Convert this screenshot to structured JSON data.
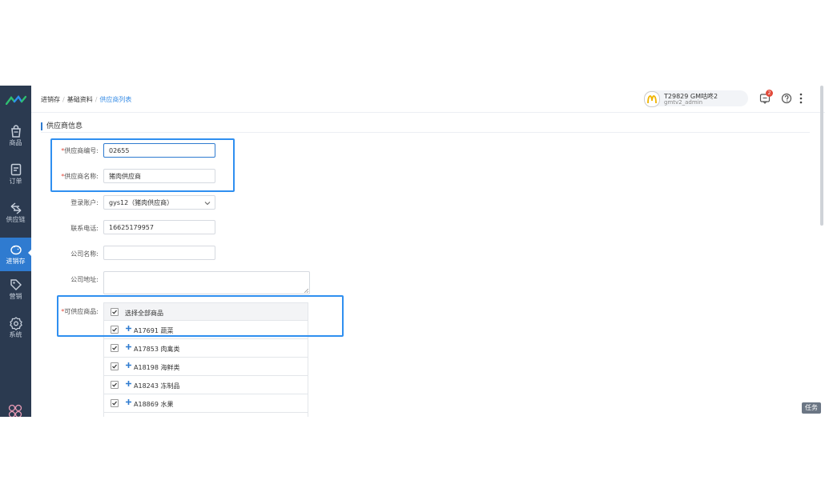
{
  "sidebar": {
    "items": [
      {
        "label": "商品",
        "icon": "shopping-bag-icon"
      },
      {
        "label": "订单",
        "icon": "order-document-icon"
      },
      {
        "label": "供应链",
        "icon": "supply-chain-arrows-icon"
      },
      {
        "label": "进销存",
        "icon": "inventory-piggy-icon",
        "active": true
      },
      {
        "label": "营销",
        "icon": "tag-icon"
      },
      {
        "label": "系统",
        "icon": "settings-gear-icon"
      }
    ]
  },
  "breadcrumb": {
    "l1": "进销存",
    "l2": "基础资料",
    "current": "供应商列表"
  },
  "header": {
    "user_name": "T29829 GM咕咚2",
    "user_role": "gmtv2_admin",
    "message_count": "2"
  },
  "section": {
    "title": "供应商信息"
  },
  "form": {
    "supplier_code": {
      "label": "供应商编号:",
      "value": "02655"
    },
    "supplier_name": {
      "label": "供应商名称:",
      "value": "猪肉供应商"
    },
    "login_account": {
      "label": "登录账户:",
      "value": "gys12（猪肉供应商）"
    },
    "phone": {
      "label": "联系电话:",
      "value": "16625179957"
    },
    "company_name": {
      "label": "公司名称:",
      "value": ""
    },
    "company_address": {
      "label": "公司地址:",
      "value": ""
    },
    "goods": {
      "label": "可供应商品:",
      "select_all": "选择全部商品",
      "items": [
        "A17691 蔬菜",
        "A17853 肉禽类",
        "A18198 海鲜类",
        "A18243 冻制品",
        "A18869 水果",
        ""
      ]
    }
  },
  "task_button": "任务",
  "colors": {
    "sidebar_bg": "#2b3a50",
    "active": "#2f7bd0",
    "highlight": "#2f8ff0",
    "required": "#e24a3b"
  }
}
